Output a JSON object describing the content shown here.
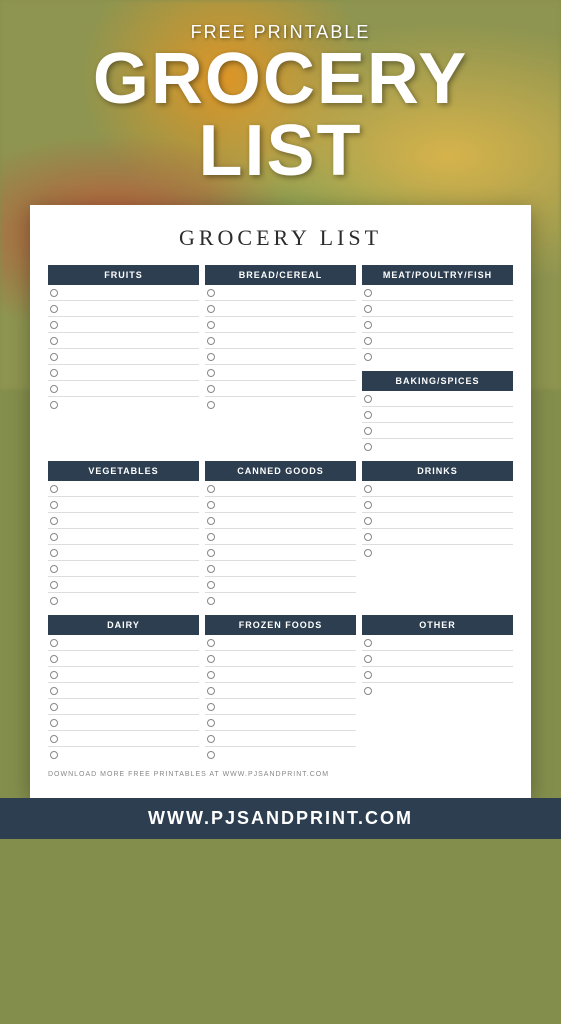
{
  "header": {
    "subtitle": "FREE PRINTABLE",
    "title_line1": "GROCERY",
    "title_line2": "LIST"
  },
  "paper": {
    "title": "GROCERY LIST",
    "categories": {
      "fruits": {
        "label": "FRUITS",
        "items": 8
      },
      "bread_cereal": {
        "label": "BREAD/CEREAL",
        "items": 8
      },
      "meat_poultry_fish": {
        "label": "MEAT/POULTRY/FISH",
        "items": 5
      },
      "baking_spices": {
        "label": "BAKING/SPICES",
        "items": 4
      },
      "vegetables": {
        "label": "VEGETABLES",
        "items": 8
      },
      "canned_goods": {
        "label": "CANNED GOODS",
        "items": 8
      },
      "drinks": {
        "label": "DRINKS",
        "items": 5
      },
      "dairy": {
        "label": "DAIRY",
        "items": 8
      },
      "frozen_foods": {
        "label": "FROZEN FOODS",
        "items": 8
      },
      "other": {
        "label": "OTHER",
        "items": 4
      }
    },
    "footer_small": "DOWNLOAD MORE FREE PRINTABLES AT WWW.PJSANDPRINT.COM"
  },
  "footer": {
    "url": "WWW.PJSANDPRINT.COM"
  }
}
